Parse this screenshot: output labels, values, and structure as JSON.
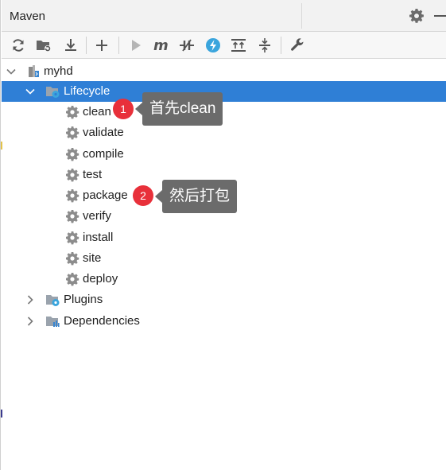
{
  "panel": {
    "title": "Maven"
  },
  "toolbar": {
    "icons": [
      "reload-icon",
      "add-project-folder-icon",
      "download-icon",
      "add-icon",
      "run-icon",
      "maven-goal-icon",
      "toggle-offline-icon",
      "skip-tests-icon",
      "show-dependencies-icon",
      "collapse-all-icon",
      "settings-wrench-icon"
    ]
  },
  "tree": {
    "project": "myhd",
    "lifecycle": "Lifecycle",
    "goals": [
      "clean",
      "validate",
      "compile",
      "test",
      "package",
      "verify",
      "install",
      "site",
      "deploy"
    ],
    "plugins": "Plugins",
    "dependencies": "Dependencies"
  },
  "annotations": [
    {
      "number": "1",
      "text": "首先clean"
    },
    {
      "number": "2",
      "text": "然后打包"
    }
  ],
  "colors": {
    "selection": "#2f7fd6",
    "badge": "#e8303a",
    "bubble": "#6b6b6b"
  }
}
